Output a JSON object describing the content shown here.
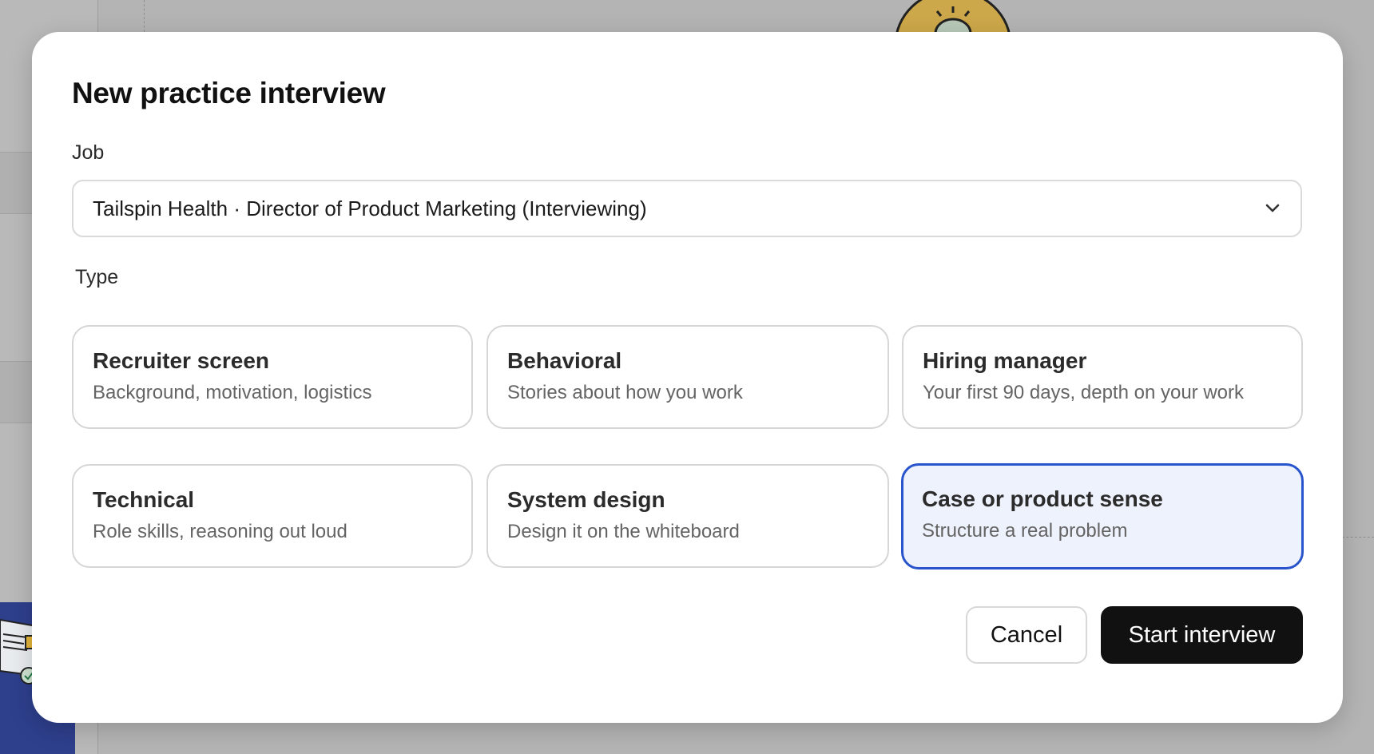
{
  "dialog": {
    "title": "New practice interview",
    "job_label": "Job",
    "job_selected": "Tailspin Health · Director of Product Marketing (Interviewing)",
    "type_label": "Type",
    "types": [
      {
        "title": "Recruiter screen",
        "subtitle": "Background, motivation, logistics",
        "selected": false
      },
      {
        "title": "Behavioral",
        "subtitle": "Stories about how you work",
        "selected": false
      },
      {
        "title": "Hiring manager",
        "subtitle": "Your first 90 days, depth on your work",
        "selected": false
      },
      {
        "title": "Technical",
        "subtitle": "Role skills, reasoning out loud",
        "selected": false
      },
      {
        "title": "System design",
        "subtitle": "Design it on the whiteboard",
        "selected": false
      },
      {
        "title": "Case or product sense",
        "subtitle": "Structure a real problem",
        "selected": true
      }
    ],
    "cancel_label": "Cancel",
    "start_label": "Start interview"
  },
  "colors": {
    "accent": "#2855cc",
    "selected_bg": "#eef2fc",
    "primary_button": "#111111",
    "backdrop": "#b4b4b4"
  },
  "icons": {
    "select_chevron": "chevron-down-icon"
  }
}
